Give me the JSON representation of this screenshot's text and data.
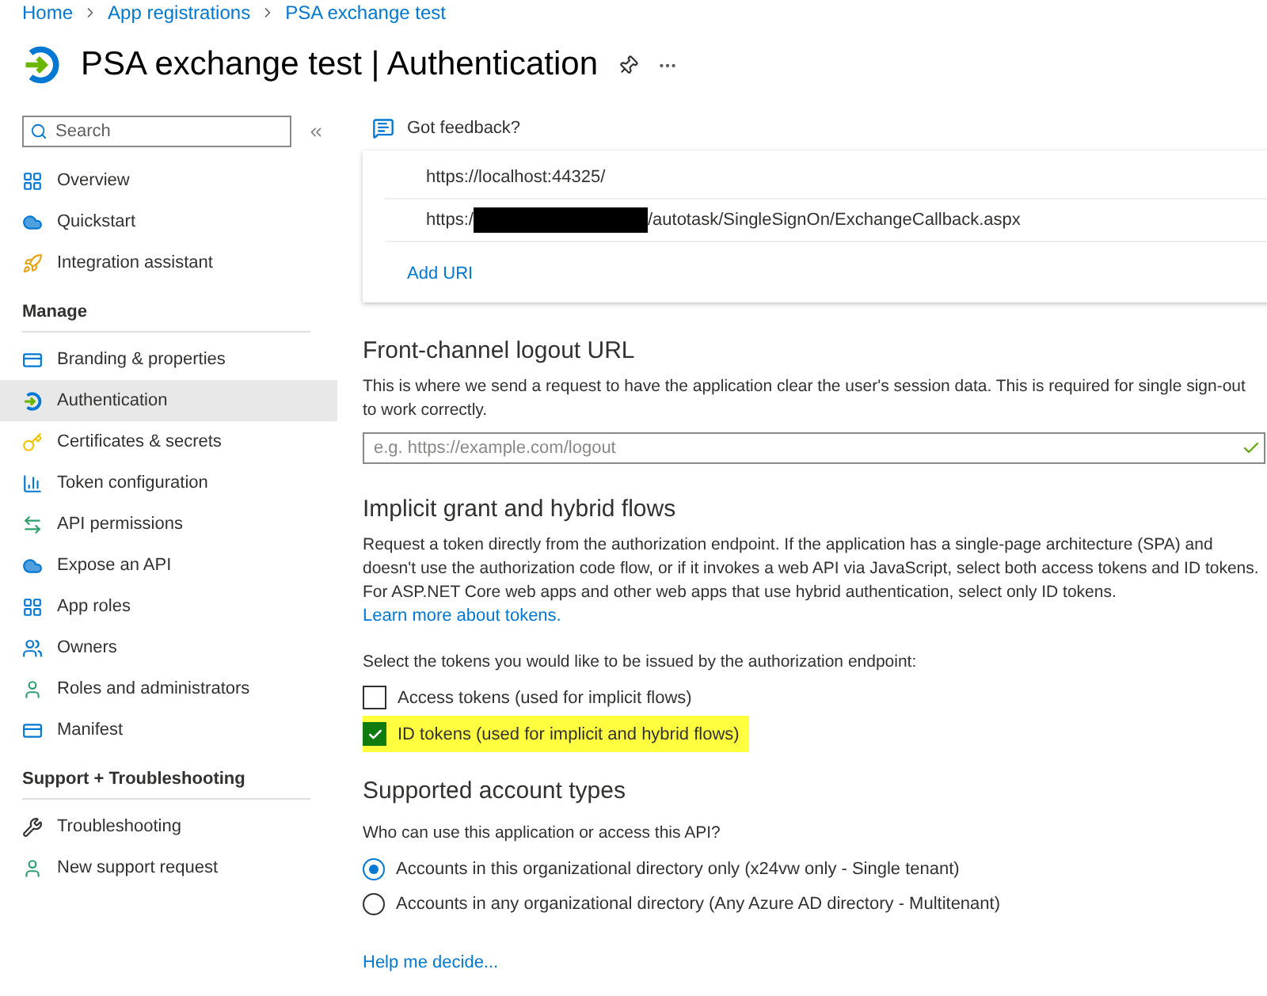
{
  "breadcrumb": [
    "Home",
    "App registrations",
    "PSA exchange test"
  ],
  "page_title": "PSA exchange test | Authentication",
  "sidebar": {
    "search": {
      "placeholder": "Search"
    },
    "sections": [
      {
        "items": [
          {
            "label": "Overview",
            "kind": "grid",
            "selected": false
          },
          {
            "label": "Quickstart",
            "kind": "cloud",
            "selected": false
          },
          {
            "label": "Integration assistant",
            "kind": "rocket",
            "selected": false
          }
        ]
      },
      {
        "title": "Manage",
        "items": [
          {
            "label": "Branding & properties",
            "kind": "card",
            "selected": false
          },
          {
            "label": "Authentication",
            "kind": "auth",
            "selected": true
          },
          {
            "label": "Certificates & secrets",
            "kind": "key",
            "selected": false
          },
          {
            "label": "Token configuration",
            "kind": "bars",
            "selected": false
          },
          {
            "label": "API permissions",
            "kind": "api",
            "selected": false
          },
          {
            "label": "Expose an API",
            "kind": "cloud",
            "selected": false
          },
          {
            "label": "App roles",
            "kind": "grid",
            "selected": false
          },
          {
            "label": "Owners",
            "kind": "people",
            "selected": false
          },
          {
            "label": "Roles and administrators",
            "kind": "person",
            "selected": false
          },
          {
            "label": "Manifest",
            "kind": "card",
            "selected": false
          }
        ]
      },
      {
        "title": "Support + Troubleshooting",
        "items": [
          {
            "label": "Troubleshooting",
            "kind": "wrench",
            "selected": false
          },
          {
            "label": "New support request",
            "kind": "person",
            "selected": false
          }
        ]
      }
    ]
  },
  "feedback": "Got feedback?",
  "redirect_uris": [
    {
      "parts": [
        "https://localhost:44325/"
      ]
    },
    {
      "parts": [
        "https:/",
        "/autotask/SingleSignOn/ExchangeCallback.aspx"
      ],
      "redacted": true
    }
  ],
  "add_uri": "Add URI",
  "logout": {
    "title": "Front-channel logout URL",
    "description": "This is where we send a request to have the application clear the user's session data. This is required for single sign-out to work correctly.",
    "placeholder": "e.g. https://example.com/logout",
    "valid": true
  },
  "implicit": {
    "title": "Implicit grant and hybrid flows",
    "description": "Request a token directly from the authorization endpoint. If the application has a single-page architecture (SPA) and doesn't use the authorization code flow, or if it invokes a web API via JavaScript, select both access tokens and ID tokens. For ASP.NET Core web apps and other web apps that use hybrid authentication, select only ID tokens.",
    "link": "Learn more about tokens.",
    "prompt": "Select the tokens you would like to be issued by the authorization endpoint:",
    "tokens": [
      {
        "label": "Access tokens (used for implicit flows)",
        "checked": false,
        "highlighted": false
      },
      {
        "label": "ID tokens (used for implicit and hybrid flows)",
        "checked": true,
        "highlighted": true
      }
    ]
  },
  "accounts": {
    "title": "Supported account types",
    "prompt": "Who can use this application or access this API?",
    "options": [
      {
        "label": "Accounts in this organizational directory only (x24vw only - Single tenant)",
        "selected": true
      },
      {
        "label": "Accounts in any organizational directory (Any Azure AD directory - Multitenant)",
        "selected": false
      }
    ],
    "help": "Help me decide..."
  }
}
